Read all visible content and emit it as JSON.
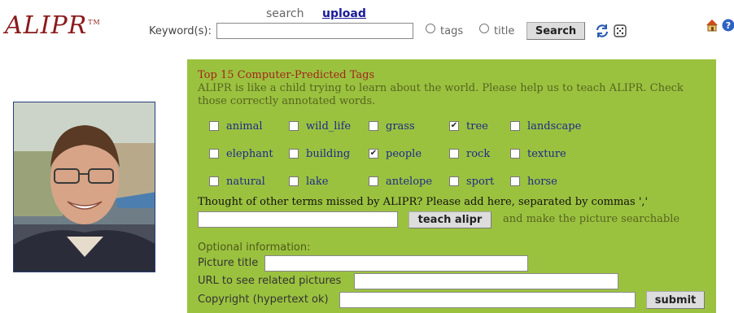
{
  "header": {
    "logo": "ALIPR",
    "logo_tm": "TM",
    "mode_search": "search",
    "mode_upload": "upload",
    "keyword_label": "Keyword(s):",
    "keyword_value": "",
    "radio_tags": "tags",
    "radio_title": "title",
    "search_button": "Search"
  },
  "panel": {
    "title": "Top 15 Computer-Predicted Tags",
    "description": "ALIPR is like a child trying to learn about the world. Please help us to teach ALIPR. Check those correctly annotated words.",
    "tags": [
      {
        "label": "animal",
        "checked": false
      },
      {
        "label": "wild_life",
        "checked": false
      },
      {
        "label": "grass",
        "checked": false
      },
      {
        "label": "tree",
        "checked": true
      },
      {
        "label": "landscape",
        "checked": false
      },
      {
        "label": "elephant",
        "checked": false
      },
      {
        "label": "building",
        "checked": false
      },
      {
        "label": "people",
        "checked": true
      },
      {
        "label": "rock",
        "checked": false
      },
      {
        "label": "texture",
        "checked": false
      },
      {
        "label": "natural",
        "checked": false
      },
      {
        "label": "lake",
        "checked": false
      },
      {
        "label": "antelope",
        "checked": false
      },
      {
        "label": "sport",
        "checked": false
      },
      {
        "label": "horse",
        "checked": false
      }
    ],
    "prompt": "Thought of other terms missed by ALIPR? Please add here, separated by commas ','",
    "teach_value": "",
    "teach_button": "teach alipr",
    "teach_suffix": "and make the picture searchable",
    "optional_heading": "Optional information:",
    "picture_title_label": "Picture title",
    "url_label": "URL to see related pictures",
    "copyright_label": "Copyright (hypertext ok)",
    "submit_button": "submit"
  },
  "colors": {
    "panel_bg": "#9bc23f",
    "logo": "#8b1a1a",
    "tag_text": "#1c2a8a",
    "panel_title": "#a0261b"
  },
  "icons": [
    "refresh-icon",
    "dice-icon",
    "home-icon",
    "help-icon"
  ]
}
